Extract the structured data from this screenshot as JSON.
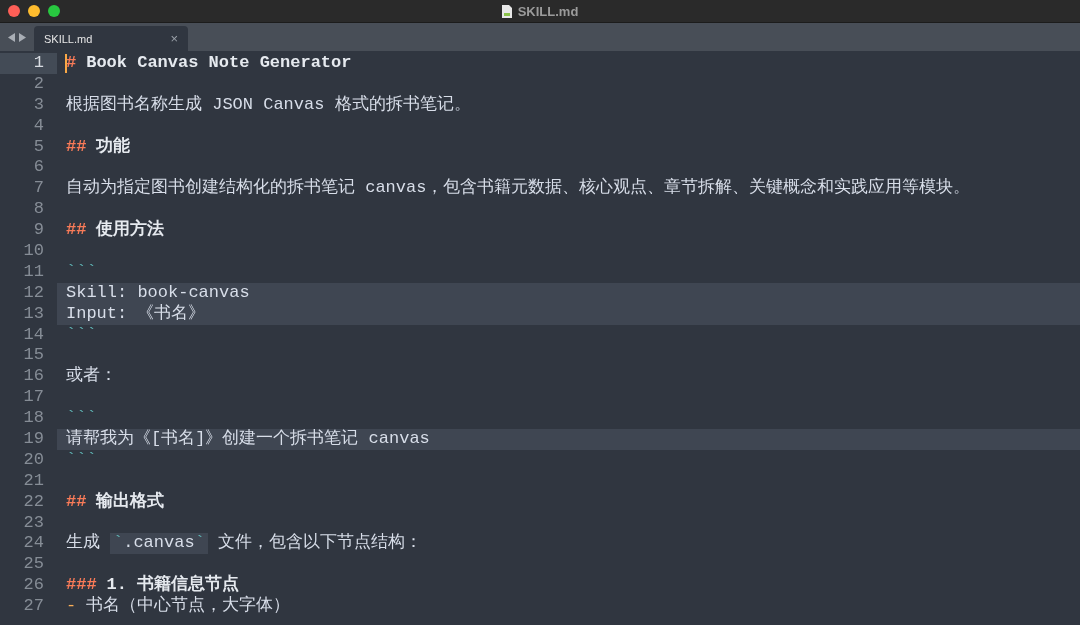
{
  "window": {
    "title": "SKILL.md"
  },
  "tabs": [
    {
      "label": "SKILL.md",
      "close": "×",
      "selected": true
    }
  ],
  "lines": [
    {
      "number": "1",
      "current": true,
      "highlighted": false,
      "segments": [
        {
          "kind": "mark",
          "text": "#"
        },
        {
          "kind": "heading",
          "text": "Book Canvas Note Generator"
        }
      ]
    },
    {
      "number": "2",
      "current": false,
      "highlighted": false
    },
    {
      "number": "3",
      "current": false,
      "highlighted": false,
      "segments": [
        {
          "kind": "text",
          "text": "根据图书名称生成 JSON Canvas 格式的拆书笔记。"
        }
      ]
    },
    {
      "number": "4",
      "current": false,
      "highlighted": false
    },
    {
      "number": "5",
      "current": false,
      "highlighted": false,
      "segments": [
        {
          "kind": "mark",
          "text": "##"
        },
        {
          "kind": "heading",
          "text": "功能"
        }
      ]
    },
    {
      "number": "6",
      "current": false,
      "highlighted": false
    },
    {
      "number": "7",
      "current": false,
      "highlighted": false,
      "segments": [
        {
          "kind": "text",
          "text": "自动为指定图书创建结构化的拆书笔记 canvas，包含书籍元数据、核心观点、章节拆解、关键概念和实践应用等模块。"
        }
      ]
    },
    {
      "number": "8",
      "current": false,
      "highlighted": false
    },
    {
      "number": "9",
      "current": false,
      "highlighted": false,
      "segments": [
        {
          "kind": "mark",
          "text": "##"
        },
        {
          "kind": "heading",
          "text": "使用方法"
        }
      ]
    },
    {
      "number": "10",
      "current": false,
      "highlighted": false
    },
    {
      "number": "11",
      "current": false,
      "highlighted": false,
      "segments": [
        {
          "kind": "fence",
          "text": "```"
        }
      ]
    },
    {
      "number": "12",
      "current": false,
      "highlighted": true,
      "segments": [
        {
          "kind": "text",
          "text": "Skill: book-canvas"
        }
      ]
    },
    {
      "number": "13",
      "current": false,
      "highlighted": true,
      "segments": [
        {
          "kind": "text",
          "text": "Input: 《书名》"
        }
      ]
    },
    {
      "number": "14",
      "current": false,
      "highlighted": false,
      "segments": [
        {
          "kind": "fence",
          "text": "```"
        }
      ]
    },
    {
      "number": "15",
      "current": false,
      "highlighted": false
    },
    {
      "number": "16",
      "current": false,
      "highlighted": false,
      "segments": [
        {
          "kind": "text",
          "text": "或者："
        }
      ]
    },
    {
      "number": "17",
      "current": false,
      "highlighted": false
    },
    {
      "number": "18",
      "current": false,
      "highlighted": false,
      "segments": [
        {
          "kind": "fence",
          "text": "```"
        }
      ]
    },
    {
      "number": "19",
      "current": false,
      "highlighted": true,
      "segments": [
        {
          "kind": "text",
          "text": "请帮我为《[书名]》创建一个拆书笔记 canvas"
        }
      ]
    },
    {
      "number": "20",
      "current": false,
      "highlighted": false,
      "segments": [
        {
          "kind": "fence",
          "text": "```"
        }
      ]
    },
    {
      "number": "21",
      "current": false,
      "highlighted": false
    },
    {
      "number": "22",
      "current": false,
      "highlighted": false,
      "segments": [
        {
          "kind": "mark",
          "text": "##"
        },
        {
          "kind": "heading",
          "text": "输出格式"
        }
      ]
    },
    {
      "number": "23",
      "current": false,
      "highlighted": false
    },
    {
      "number": "24",
      "current": false,
      "highlighted": false,
      "segments": [
        {
          "kind": "text",
          "text": "生成"
        },
        {
          "kind": "inline-code",
          "text": "`.canvas`"
        },
        {
          "kind": "text",
          "text": "文件，包含以下节点结构："
        }
      ]
    },
    {
      "number": "25",
      "current": false,
      "highlighted": false
    },
    {
      "number": "26",
      "current": false,
      "highlighted": false,
      "segments": [
        {
          "kind": "mark",
          "text": "###"
        },
        {
          "kind": "heading",
          "text": "1. 书籍信息节点"
        }
      ]
    },
    {
      "number": "27",
      "current": false,
      "highlighted": false,
      "segments": [
        {
          "kind": "bullet",
          "text": "-"
        },
        {
          "kind": "text",
          "text": "书名（中心节点，大字体）"
        }
      ]
    }
  ]
}
